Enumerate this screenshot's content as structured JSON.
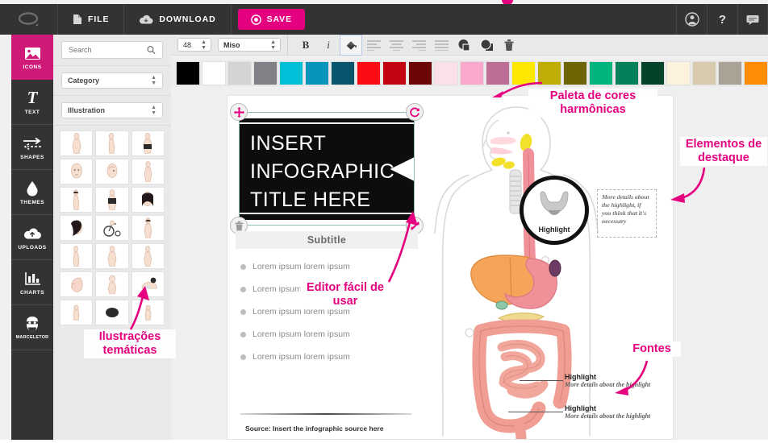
{
  "header": {
    "logo_icon": "brain-icon",
    "buttons": [
      {
        "label": "FILE",
        "icon": "file-icon"
      },
      {
        "label": "DOWNLOAD",
        "icon": "cloud-download-icon"
      },
      {
        "label": "SAVE",
        "icon": "record-circle-icon",
        "accent": "#e4007f"
      }
    ],
    "right_icons": [
      "user-account-icon",
      "help-question-icon",
      "chat-bubble-icon"
    ],
    "help_label": "?"
  },
  "rail": {
    "items": [
      {
        "label": "ICONS",
        "icon": "image-icon",
        "active": true
      },
      {
        "label": "TEXT",
        "icon": "text-t-icon",
        "active": false
      },
      {
        "label": "SHAPES",
        "icon": "arrows-icon",
        "active": false
      },
      {
        "label": "THEMES",
        "icon": "droplet-icon",
        "active": false
      },
      {
        "label": "UPLOADS",
        "icon": "cloud-upload-icon",
        "active": false
      },
      {
        "label": "CHARTS",
        "icon": "bar-chart-icon",
        "active": false
      },
      {
        "label": "MARCELETOR",
        "icon": "avatar-face-icon",
        "active": false
      }
    ]
  },
  "left_panel": {
    "search_placeholder": "Search",
    "search_value": "",
    "category_select": "Category",
    "type_select": "Illustration",
    "thumbnail_count": 21,
    "thumbnail_name": "human-body-illustration-thumbnail"
  },
  "toolbar": {
    "font_size": "48",
    "font_family": "Miso",
    "bold_label": "B",
    "italic_label": "i",
    "buttons": [
      {
        "name": "fill-color-button",
        "icon": "paint-bucket-icon",
        "selected": true
      },
      {
        "name": "align-left-button",
        "icon": "align-left-icon"
      },
      {
        "name": "align-center-button",
        "icon": "align-center-icon"
      },
      {
        "name": "align-right-button",
        "icon": "align-right-icon"
      },
      {
        "name": "align-justify-button",
        "icon": "align-justify-icon"
      },
      {
        "name": "bring-front-button",
        "icon": "layer-front-icon"
      },
      {
        "name": "send-back-button",
        "icon": "layer-back-icon"
      },
      {
        "name": "delete-button",
        "icon": "trash-icon"
      }
    ]
  },
  "palette": {
    "colors": [
      "#000000",
      "#ffffff",
      "#d4d4d6",
      "#808086",
      "#00c0d8",
      "#0795bc",
      "#08566e",
      "#fb0d13",
      "#c20511",
      "#6e0606",
      "#fbdfe9",
      "#fba8cd",
      "#bd6e96",
      "#ffe800",
      "#c0ad04",
      "#6e6404",
      "#00b67e",
      "#04805a",
      "#04432a",
      "#fdf2db",
      "#d8cbad",
      "#aba296",
      "#ff8c04"
    ]
  },
  "canvas": {
    "title_text": "INSERT INFOGRAPHIC TITLE HERE",
    "title_lines": [
      "INSERT",
      "INFOGRAPHIC",
      "TITLE HERE"
    ],
    "subtitle": "Subtitle",
    "bullets": [
      "Lorem ipsum lorem ipsum",
      "Lorem ipsum lorem ipsum",
      "Lorem ipsum lorem ipsum",
      "Lorem ipsum lorem ipsum",
      "Lorem ipsum lorem ipsum"
    ],
    "source": "Source: Insert the infographic source here",
    "highlight_circle_label": "Highlight",
    "highlight_note": "More details about the highlight, if you think that it's necessary",
    "callouts": [
      {
        "title": "Highlight",
        "desc": "More details about the highlight"
      },
      {
        "title": "Highlight",
        "desc": "More details about the highlight"
      }
    ],
    "selection_handles": [
      {
        "name": "move-handle",
        "icon": "move-cross-icon"
      },
      {
        "name": "rotate-handle",
        "icon": "rotate-icon"
      },
      {
        "name": "delete-handle",
        "icon": "trash-icon"
      },
      {
        "name": "resize-handle",
        "icon": "resize-diagonal-icon"
      }
    ]
  },
  "annotations": {
    "accent_color": "#e4007f",
    "items": [
      {
        "id": "palette",
        "text": "Paleta de cores harmônicas"
      },
      {
        "id": "highlight",
        "text": "Elementos de destaque"
      },
      {
        "id": "editor",
        "text": "Editor fácil de usar"
      },
      {
        "id": "fonts",
        "text": "Fontes"
      },
      {
        "id": "illustrations",
        "text": "Ilustrações temáticas"
      }
    ]
  }
}
